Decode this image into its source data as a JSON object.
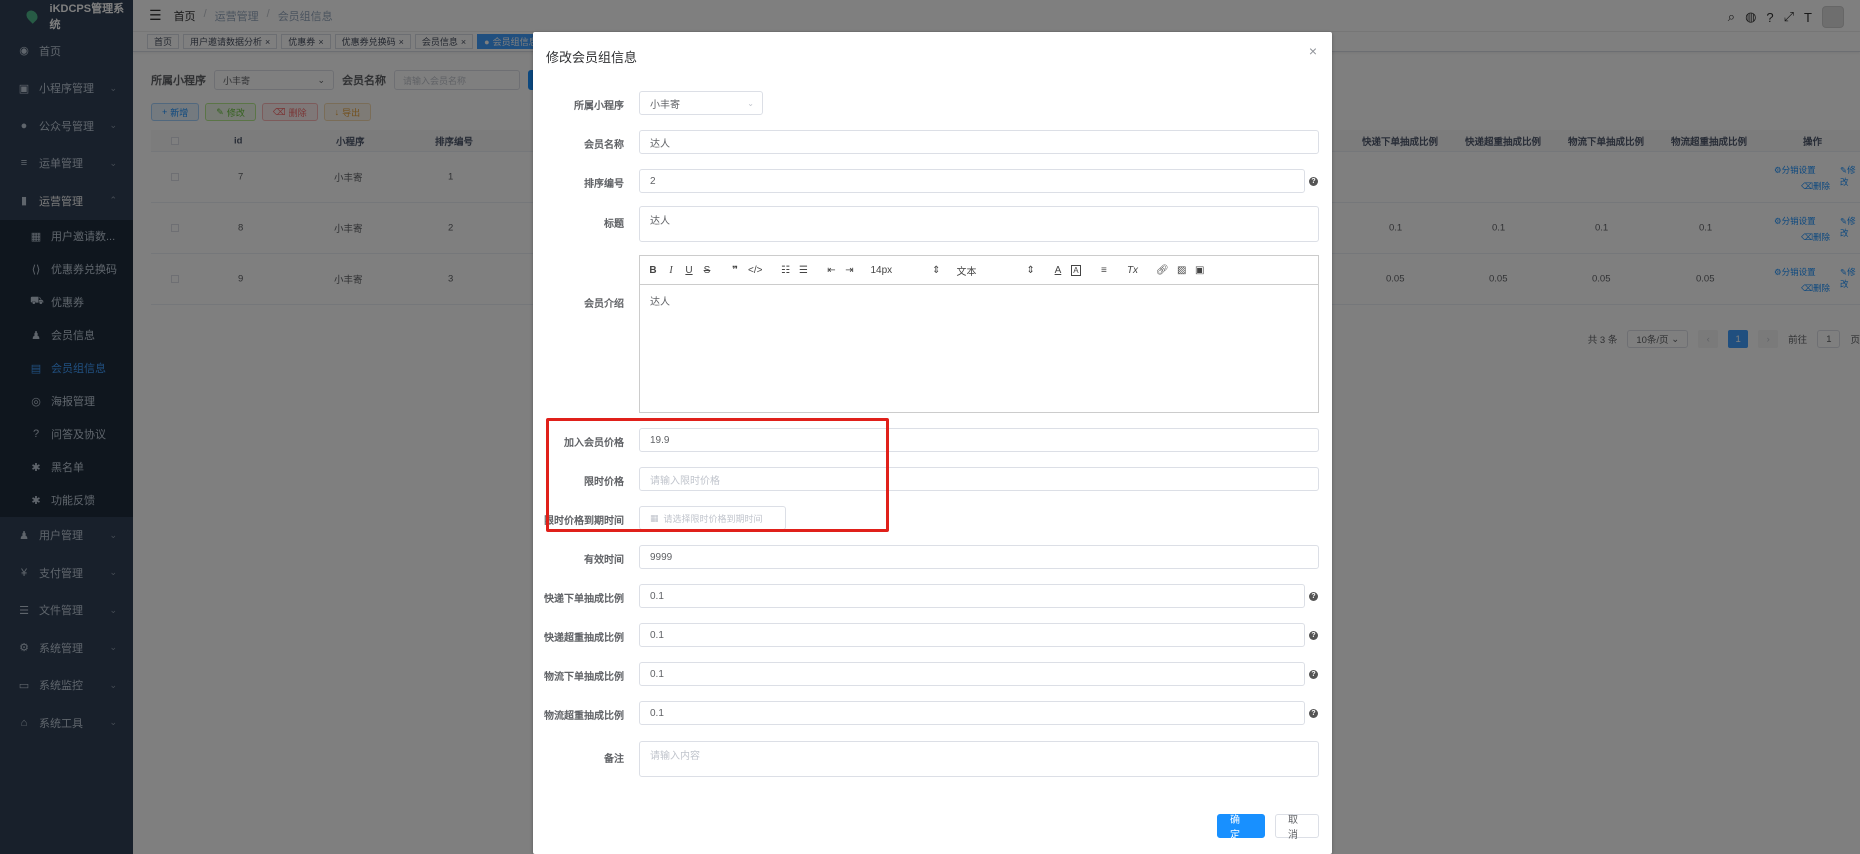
{
  "app": {
    "title": "iKDCPS管理系统"
  },
  "sidebar": {
    "items": [
      {
        "label": "首页",
        "icon": "dashboard-icon"
      },
      {
        "label": "小程序管理",
        "icon": "miniprogram-icon"
      },
      {
        "label": "公众号管理",
        "icon": "wechat-icon"
      },
      {
        "label": "运单管理",
        "icon": "list-icon"
      },
      {
        "label": "运营管理",
        "icon": "chart-icon"
      }
    ],
    "sub_items": [
      {
        "label": "用户邀请数..."
      },
      {
        "label": "优惠券兑换码"
      },
      {
        "label": "优惠券"
      },
      {
        "label": "会员信息"
      },
      {
        "label": "会员组信息"
      },
      {
        "label": "海报管理"
      },
      {
        "label": "问答及协议"
      },
      {
        "label": "黑名单"
      },
      {
        "label": "功能反馈"
      }
    ],
    "bottom_items": [
      {
        "label": "用户管理"
      },
      {
        "label": "支付管理"
      },
      {
        "label": "文件管理"
      },
      {
        "label": "系统管理"
      },
      {
        "label": "系统监控"
      },
      {
        "label": "系统工具"
      }
    ]
  },
  "navbar": {
    "breadcrumb": [
      "首页",
      "运营管理",
      "会员组信息"
    ]
  },
  "tags": [
    "首页",
    "用户邀请数据分析",
    "优惠券",
    "优惠券兑换码",
    "会员信息",
    "会员组信息"
  ],
  "filter": {
    "miniprogram_label": "所属小程序",
    "miniprogram_value": "小丰寄",
    "name_label": "会员名称",
    "name_placeholder": "请输入会员名称"
  },
  "actions": {
    "add": "新增",
    "edit": "修改",
    "delete": "删除",
    "export": "导出"
  },
  "table": {
    "headers": {
      "id": "id",
      "mini": "小程序",
      "order": "排序编号",
      "c1": "快递下单抽成比例",
      "c2": "快递超重抽成比例",
      "c3": "物流下单抽成比例",
      "c4": "物流超重抽成比例",
      "ops": "操作"
    },
    "rows": [
      {
        "id": "7",
        "mini": "小丰寄",
        "order": "1",
        "c1": "",
        "c2": "",
        "c3": "",
        "c4": ""
      },
      {
        "id": "8",
        "mini": "小丰寄",
        "order": "2",
        "c1": "0.1",
        "c2": "0.1",
        "c3": "0.1",
        "c4": "0.1"
      },
      {
        "id": "9",
        "mini": "小丰寄",
        "order": "3",
        "c1": "0.05",
        "c2": "0.05",
        "c3": "0.05",
        "c4": "0.05"
      }
    ],
    "op_labels": {
      "dist": "分销设置",
      "edit": "修改",
      "del": "删除"
    }
  },
  "pager": {
    "total": "共 3 条",
    "size": "10条/页",
    "page": "1",
    "goto": "前往",
    "goto_val": "1",
    "unit": "页"
  },
  "dialog": {
    "title": "修改会员组信息",
    "fields": {
      "mini_label": "所属小程序",
      "mini_value": "小丰寄",
      "name_label": "会员名称",
      "name_value": "达人",
      "order_label": "排序编号",
      "order_value": "2",
      "title_label": "标题",
      "title_value": "达人",
      "intro_label": "会员介绍",
      "intro_value": "达人",
      "price_label": "加入会员价格",
      "price_value": "19.9",
      "limit_label": "限时价格",
      "limit_placeholder": "请输入限时价格",
      "limit_time_label": "限时价格到期时间",
      "limit_time_placeholder": "请选择限时价格到期时间",
      "valid_label": "有效时间",
      "valid_value": "9999",
      "c1_label": "快递下单抽成比例",
      "c1_value": "0.1",
      "c2_label": "快递超重抽成比例",
      "c2_value": "0.1",
      "c3_label": "物流下单抽成比例",
      "c3_value": "0.1",
      "c4_label": "物流超重抽成比例",
      "c4_value": "0.1",
      "remark_label": "备注",
      "remark_placeholder": "请输入内容"
    },
    "editor": {
      "font_size": "14px",
      "block": "文本"
    },
    "confirm": "确 定",
    "cancel": "取 消"
  },
  "colors": {
    "primary": "#1890ff",
    "highlight": "#e0201a",
    "sidebar": "#304156"
  }
}
